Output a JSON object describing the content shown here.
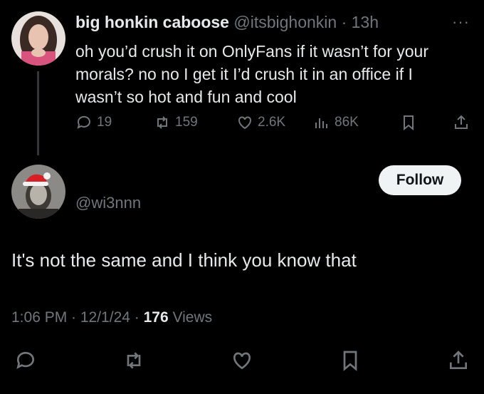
{
  "reply_to": {
    "display_name": "big honkin caboose",
    "handle": "@itsbighonkin",
    "separator": "·",
    "time": "13h",
    "more_label": "···",
    "text": "oh you’d crush it on OnlyFans if it wasn’t for your morals? no no I get it I’d crush it in an office if I wasn’t so hot and fun and cool",
    "stats": {
      "replies": "19",
      "reposts": "159",
      "likes": "2.6K",
      "views": "86K"
    }
  },
  "tweet": {
    "handle": "@wi3nnn",
    "follow_label": "Follow",
    "text": "It's not the same and I think you know that",
    "timestamp": "1:06 PM · 12/1/24 · ",
    "view_count": "176",
    "views_label": " Views"
  },
  "icons": {
    "reply": "reply-icon",
    "repost": "repost-icon",
    "like": "like-icon",
    "views": "views-icon",
    "bookmark": "bookmark-icon",
    "share": "share-icon"
  },
  "colors": {
    "background": "#000000",
    "text_primary": "#e7e9ea",
    "text_secondary": "#71767b",
    "follow_bg": "#eff3f4"
  }
}
